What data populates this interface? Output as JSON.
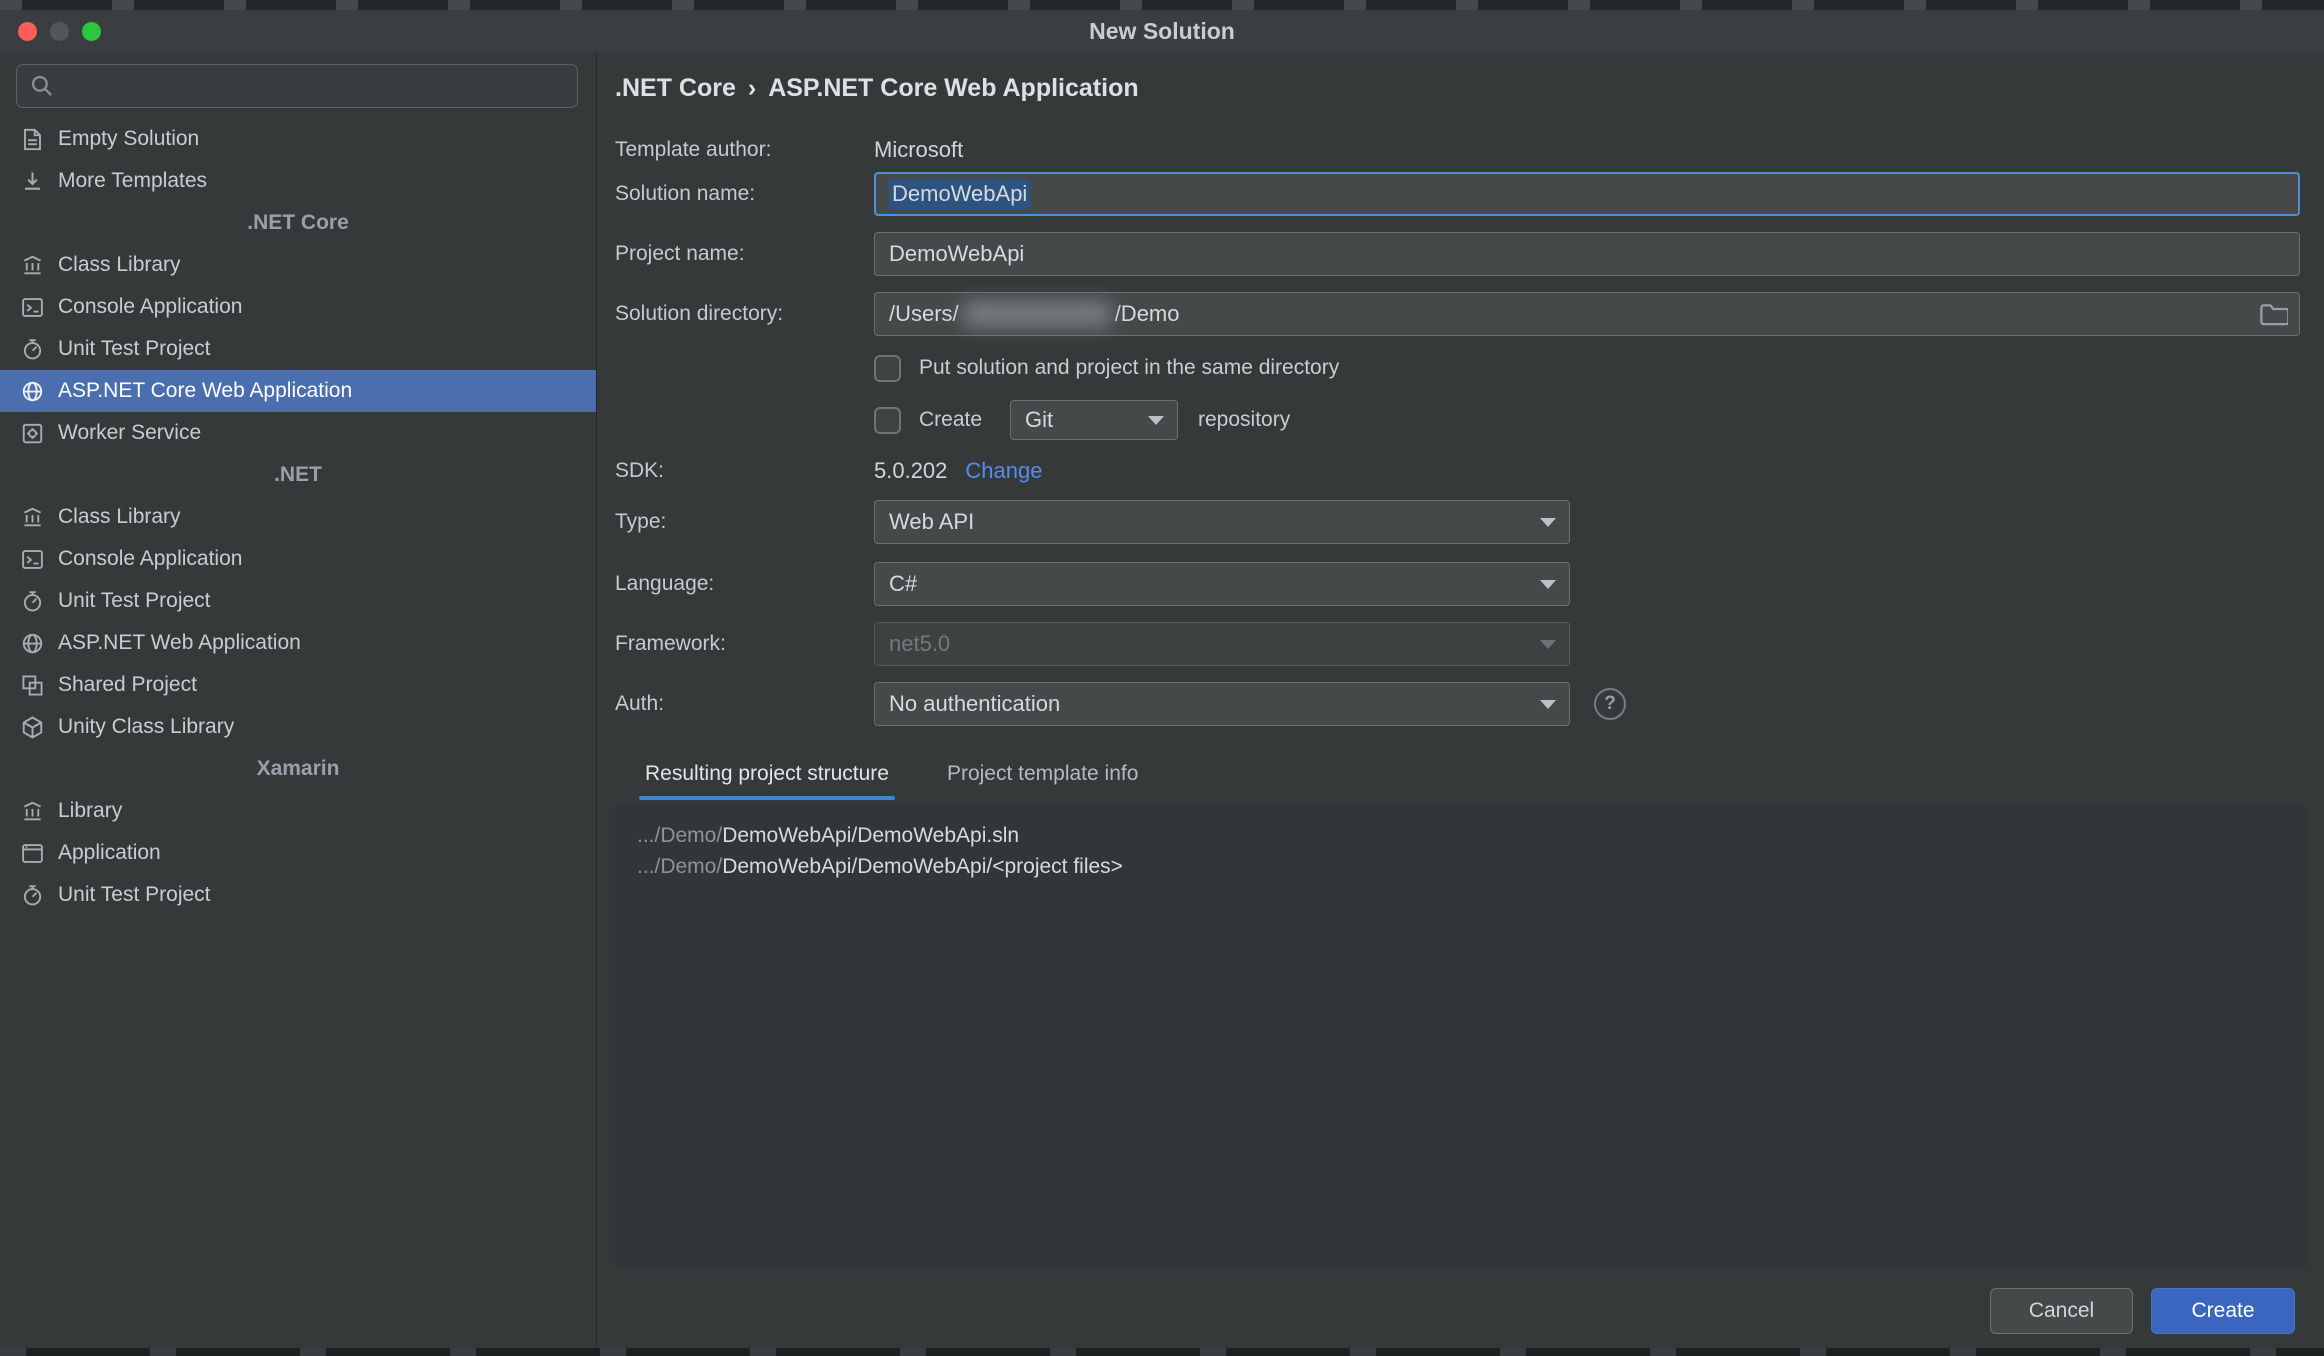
{
  "window": {
    "title": "New Solution"
  },
  "sidebar": {
    "search_placeholder": "",
    "groups": [
      {
        "items": [
          {
            "label": "Empty Solution",
            "icon": "solution-icon"
          },
          {
            "label": "More Templates",
            "icon": "download-icon"
          }
        ]
      },
      {
        "header": ".NET Core",
        "items": [
          {
            "label": "Class Library",
            "icon": "library-icon"
          },
          {
            "label": "Console Application",
            "icon": "console-icon"
          },
          {
            "label": "Unit Test Project",
            "icon": "test-icon"
          },
          {
            "label": "ASP.NET Core Web Application",
            "icon": "globe-icon",
            "selected": true
          },
          {
            "label": "Worker Service",
            "icon": "worker-icon"
          }
        ]
      },
      {
        "header": ".NET",
        "items": [
          {
            "label": "Class Library",
            "icon": "library-icon"
          },
          {
            "label": "Console Application",
            "icon": "console-icon"
          },
          {
            "label": "Unit Test Project",
            "icon": "test-icon"
          },
          {
            "label": "ASP.NET Web Application",
            "icon": "globe-icon"
          },
          {
            "label": "Shared Project",
            "icon": "shared-icon"
          },
          {
            "label": "Unity Class Library",
            "icon": "unity-icon"
          }
        ]
      },
      {
        "header": "Xamarin",
        "items": [
          {
            "label": "Library",
            "icon": "library-icon"
          },
          {
            "label": "Application",
            "icon": "app-icon"
          },
          {
            "label": "Unit Test Project",
            "icon": "test-icon"
          }
        ]
      }
    ]
  },
  "main": {
    "breadcrumb": {
      "parent": ".NET Core",
      "separator": "›",
      "current": "ASP.NET Core Web Application"
    },
    "fields": {
      "template_author": {
        "label": "Template author:",
        "value": "Microsoft"
      },
      "solution_name": {
        "label": "Solution name:",
        "value": "DemoWebApi",
        "focused": true,
        "text_selected": true
      },
      "project_name": {
        "label": "Project name:",
        "value": "DemoWebApi"
      },
      "solution_directory": {
        "label": "Solution directory:",
        "prefix": "/Users/",
        "suffix": "/Demo",
        "redacted": true
      },
      "same_directory": {
        "label": "Put solution and project in the same directory",
        "checked": false
      },
      "repository": {
        "create_label": "Create",
        "vcs": "Git",
        "suffix_label": "repository",
        "checked": false
      },
      "sdk": {
        "label": "SDK:",
        "value": "5.0.202",
        "change_link": "Change"
      },
      "type": {
        "label": "Type:",
        "value": "Web API"
      },
      "language": {
        "label": "Language:",
        "value": "C#"
      },
      "framework": {
        "label": "Framework:",
        "value": "net5.0",
        "disabled": true
      },
      "auth": {
        "label": "Auth:",
        "value": "No authentication",
        "help_glyph": "?"
      }
    },
    "tabs": [
      {
        "label": "Resulting project structure",
        "active": true
      },
      {
        "label": "Project template info",
        "active": false
      }
    ],
    "structure": {
      "lines": [
        {
          "muted": ".../Demo/",
          "path": "DemoWebApi/DemoWebApi.sln"
        },
        {
          "muted": ".../Demo/",
          "path": "DemoWebApi/DemoWebApi/<project files>"
        }
      ]
    },
    "buttons": {
      "cancel": "Cancel",
      "create": "Create"
    }
  },
  "colors": {
    "selection": "#4b6eaf",
    "focus_border": "#4f8fd6",
    "link": "#548cf0",
    "create_button": "#3a66c0",
    "text_selection_bg": "#2d5380"
  }
}
